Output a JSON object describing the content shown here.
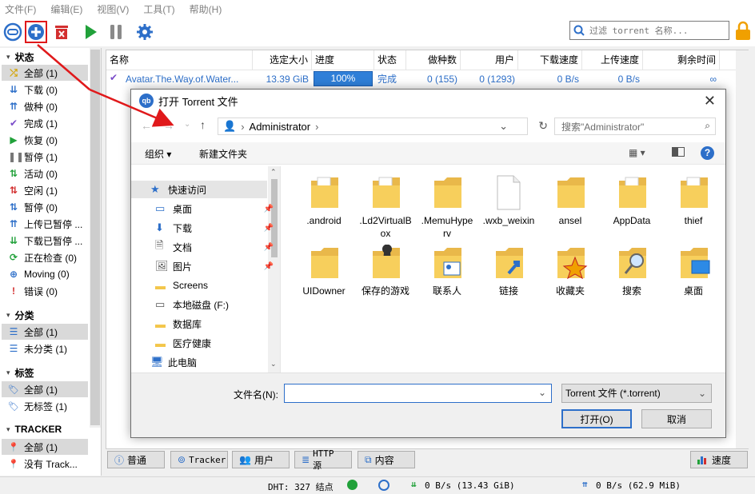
{
  "menu": [
    "文件(F)",
    "编辑(E)",
    "视图(V)",
    "工具(T)",
    "帮助(H)"
  ],
  "search": {
    "placeholder": "过滤 torrent 名称..."
  },
  "sidebar": {
    "status_header": "状态",
    "status_items": [
      {
        "icon": "shuffle-icon",
        "glyph": "⤮",
        "color": "#d4a400",
        "label": "全部 (1)",
        "selected": true
      },
      {
        "icon": "download-icon",
        "glyph": "⇊",
        "color": "#2d6fc9",
        "label": "下载 (0)"
      },
      {
        "icon": "seed-icon",
        "glyph": "⇈",
        "color": "#2d6fc9",
        "label": "做种 (0)"
      },
      {
        "icon": "check-icon",
        "glyph": "✔",
        "color": "#7a4cc9",
        "label": "完成 (1)"
      },
      {
        "icon": "resume-icon",
        "glyph": "▶",
        "color": "#21a13a",
        "label": "恢复 (0)"
      },
      {
        "icon": "pause-icon",
        "glyph": "❚❚",
        "color": "#777777",
        "label": "暂停 (1)"
      },
      {
        "icon": "active-icon",
        "glyph": "⇅",
        "color": "#21a13a",
        "label": "活动 (0)"
      },
      {
        "icon": "inactive-icon",
        "glyph": "⇅",
        "color": "#d32f2f",
        "label": "空闲 (1)"
      },
      {
        "icon": "stalled-icon",
        "glyph": "⇅",
        "color": "#2d6fc9",
        "label": "暂停 (0)"
      },
      {
        "icon": "upload-paused-icon",
        "glyph": "⇈",
        "color": "#2d6fc9",
        "label": "上传已暂停 ..."
      },
      {
        "icon": "download-paused-icon",
        "glyph": "⇊",
        "color": "#21a13a",
        "label": "下载已暂停 ..."
      },
      {
        "icon": "checking-icon",
        "glyph": "⟳",
        "color": "#21a13a",
        "label": "正在检查 (0)"
      },
      {
        "icon": "moving-icon",
        "glyph": "⊕",
        "color": "#2d6fc9",
        "label": "Moving (0)"
      },
      {
        "icon": "error-icon",
        "glyph": "!",
        "color": "#d32f2f",
        "label": "错误 (0)"
      }
    ],
    "category_header": "分类",
    "category_items": [
      {
        "icon": "list-icon",
        "label": "全部 (1)",
        "selected": true
      },
      {
        "icon": "list-icon",
        "label": "未分类 (1)"
      }
    ],
    "tag_header": "标签",
    "tag_items": [
      {
        "icon": "tag-icon",
        "label": "全部 (1)",
        "selected": true
      },
      {
        "icon": "tag-icon",
        "label": "无标签 (1)"
      }
    ],
    "tracker_header": "TRACKER",
    "tracker_items": [
      {
        "icon": "location-icon",
        "label": "全部 (1)",
        "selected": true
      },
      {
        "icon": "location-icon",
        "label": "没有 Track..."
      }
    ]
  },
  "table": {
    "columns": [
      "名称",
      "选定大小",
      "进度",
      "状态",
      "做种数",
      "用户",
      "下载速度",
      "上传速度",
      "剩余时间"
    ],
    "row": {
      "name": "Avatar.The.Way.of.Water...",
      "size": "13.39 GiB",
      "progress_label": "100%",
      "progress": 1.0,
      "status": "完成",
      "seeds": "0 (155)",
      "peers": "0 (1293)",
      "down_speed": "0 B/s",
      "up_speed": "0 B/s",
      "eta": "∞"
    }
  },
  "tabs": [
    {
      "icon": "info-icon",
      "label": "普通"
    },
    {
      "icon": "tracker-icon",
      "label": "Tracker"
    },
    {
      "icon": "users-icon",
      "label": "用户"
    },
    {
      "icon": "http-icon",
      "label": "HTTP 源"
    },
    {
      "icon": "content-icon",
      "label": "内容"
    }
  ],
  "speed_tab": "速度",
  "statusbar": {
    "dht": "DHT: 327 结点",
    "down": "0 B/s (13.43 GiB)",
    "up": "0 B/s (62.9 MiB)"
  },
  "dialog": {
    "title": "打开 Torrent 文件",
    "breadcrumb": "Administrator",
    "search_placeholder": "搜索\"Administrator\"",
    "organize": "组织",
    "new_folder": "新建文件夹",
    "nav": [
      {
        "icon": "star-icon",
        "label": "快速访问"
      },
      {
        "icon": "desktop-icon",
        "label": "桌面",
        "pinned": true
      },
      {
        "icon": "download-arrow-icon",
        "label": "下载",
        "pinned": true
      },
      {
        "icon": "document-icon",
        "label": "文档",
        "pinned": true
      },
      {
        "icon": "picture-icon",
        "label": "图片",
        "pinned": true
      },
      {
        "icon": "folder-icon",
        "label": "Screens"
      },
      {
        "icon": "drive-icon",
        "label": "本地磁盘 (F:)"
      },
      {
        "icon": "folder-icon",
        "label": "数据库"
      },
      {
        "icon": "folder-icon",
        "label": "医疗健康"
      },
      {
        "icon": "computer-icon",
        "label": "此电脑"
      }
    ],
    "files": [
      {
        "icon": "folder-doc-icon",
        "label": ".android"
      },
      {
        "icon": "folder-doc-icon",
        "label": ".Ld2VirtualBox"
      },
      {
        "icon": "folder-icon",
        "label": ".MemuHyperv"
      },
      {
        "icon": "file-icon",
        "label": ".wxb_weixin"
      },
      {
        "icon": "folder-icon",
        "label": "ansel"
      },
      {
        "icon": "folder-doc-icon",
        "label": "AppData"
      },
      {
        "icon": "folder-doc-icon",
        "label": "thief"
      },
      {
        "icon": "folder-icon",
        "label": "UIDowner"
      },
      {
        "icon": "chess-folder-icon",
        "label": "保存的游戏"
      },
      {
        "icon": "contacts-folder-icon",
        "label": "联系人"
      },
      {
        "icon": "link-folder-icon",
        "label": "链接"
      },
      {
        "icon": "favorites-folder-icon",
        "label": "收藏夹"
      },
      {
        "icon": "search-folder-icon",
        "label": "搜索"
      },
      {
        "icon": "desktop-folder-icon",
        "label": "桌面"
      }
    ],
    "filename_label": "文件名(N):",
    "filename_value": "",
    "filetype": "Torrent 文件 (*.torrent)",
    "open": "打开(O)",
    "cancel": "取消"
  },
  "colors": {
    "accent": "#2d6fc9",
    "progress": "#2f7fd8",
    "annotation": "#e0191b"
  }
}
